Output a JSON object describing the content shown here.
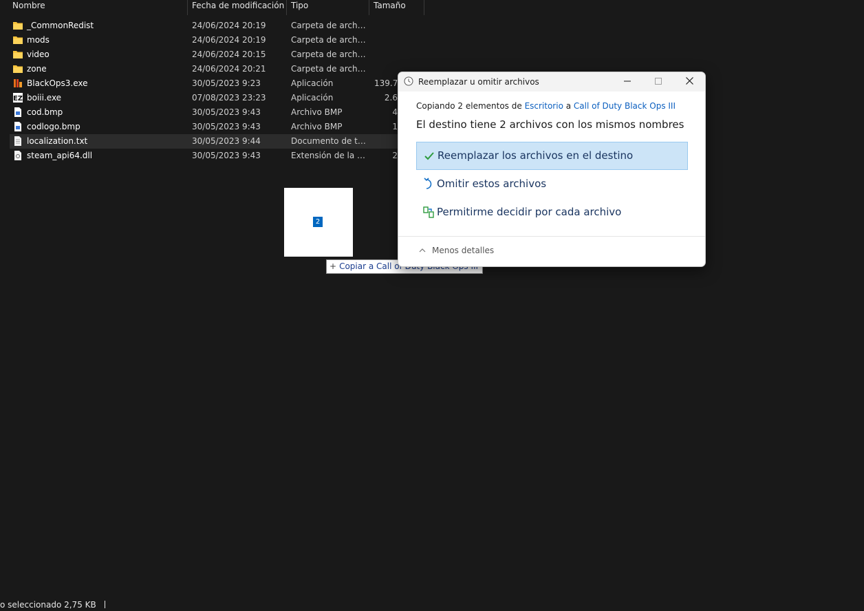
{
  "explorer": {
    "columns": {
      "name": "Nombre",
      "modified": "Fecha de modificación",
      "type": "Tipo",
      "size": "Tamaño"
    },
    "files": [
      {
        "name": "_CommonRedist",
        "modified": "24/06/2024 20:19",
        "type": "Carpeta de archivos",
        "size": "",
        "icon": "folder-icon"
      },
      {
        "name": "mods",
        "modified": "24/06/2024 20:19",
        "type": "Carpeta de archivos",
        "size": "",
        "icon": "folder-icon"
      },
      {
        "name": "video",
        "modified": "24/06/2024 20:15",
        "type": "Carpeta de archivos",
        "size": "",
        "icon": "folder-icon"
      },
      {
        "name": "zone",
        "modified": "24/06/2024 20:21",
        "type": "Carpeta de archivos",
        "size": "",
        "icon": "folder-icon"
      },
      {
        "name": "BlackOps3.exe",
        "modified": "30/05/2023 9:23",
        "type": "Aplicación",
        "size": "139.7",
        "icon": "blackops-app-icon"
      },
      {
        "name": "boiii.exe",
        "modified": "07/08/2023 23:23",
        "type": "Aplicación",
        "size": "2.6",
        "icon": "boiii-app-icon"
      },
      {
        "name": "cod.bmp",
        "modified": "30/05/2023 9:43",
        "type": "Archivo BMP",
        "size": "4",
        "icon": "image-file-icon"
      },
      {
        "name": "codlogo.bmp",
        "modified": "30/05/2023 9:43",
        "type": "Archivo BMP",
        "size": "1",
        "icon": "image-file-icon"
      },
      {
        "name": "localization.txt",
        "modified": "30/05/2023 9:44",
        "type": "Documento de te...",
        "size": "",
        "icon": "text-file-icon",
        "selected": true
      },
      {
        "name": "steam_api64.dll",
        "modified": "30/05/2023 9:43",
        "type": "Extensión de la ap...",
        "size": "2",
        "icon": "dll-file-icon"
      }
    ],
    "status_text": "o seleccionado  2,75 KB"
  },
  "drag": {
    "count_badge": "2",
    "tooltip_plus": "+",
    "tooltip": "Copiar a Call of Duty Black Ops III"
  },
  "dialog": {
    "title": "Reemplazar u omitir archivos",
    "copy_prefix": "Copiando 2 elementos de ",
    "copy_source": "Escritorio",
    "copy_mid": " a ",
    "copy_dest": "Call of Duty Black Ops III",
    "conflict_text": "El destino tiene 2 archivos con los mismos nombres",
    "options": {
      "replace": "Reemplazar los archivos en el destino",
      "skip": "Omitir estos archivos",
      "decide": "Permitirme decidir por cada archivo"
    },
    "less_details": "Menos detalles",
    "accent_color": "#0067c0",
    "selected_option_bg": "#cce4f7"
  }
}
